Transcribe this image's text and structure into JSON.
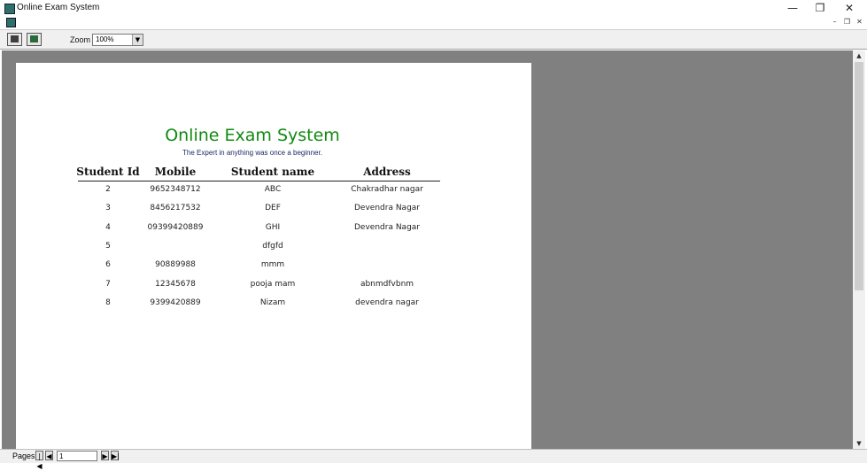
{
  "window": {
    "title": "Online Exam System",
    "controls": {
      "minimize": "—",
      "restore": "❐",
      "close": "✕"
    },
    "mdi_controls": {
      "minimize": "–",
      "restore": "❐",
      "close": "✕"
    }
  },
  "toolbar": {
    "zoom_label": "Zoom",
    "zoom_value": "100%",
    "zoom_arrow": "▼"
  },
  "report": {
    "title": "Online Exam System",
    "subtitle": "The Expert in anything was once a beginner.",
    "columns": [
      "Student Id",
      "Mobile",
      "Student name",
      "Address"
    ],
    "rows": [
      [
        "2",
        "9652348712",
        "ABC",
        "Chakradhar nagar"
      ],
      [
        "3",
        "8456217532",
        "DEF",
        "Devendra Nagar"
      ],
      [
        "4",
        "09399420889",
        "GHI",
        "Devendra Nagar"
      ],
      [
        "5",
        "",
        "dfgfd",
        ""
      ],
      [
        "6",
        "90889988",
        "mmm",
        ""
      ],
      [
        "7",
        "12345678",
        "pooja mam",
        "abnmdfvbnm"
      ],
      [
        "8",
        "9399420889",
        "Nizam",
        "devendra nagar"
      ]
    ]
  },
  "statusbar": {
    "pages_label": "Pages:",
    "current_page": "1",
    "first": "|◀",
    "prev": "◀",
    "next": "▶",
    "last": "▶|"
  },
  "scrollbar": {
    "up": "▲",
    "down": "▼"
  }
}
